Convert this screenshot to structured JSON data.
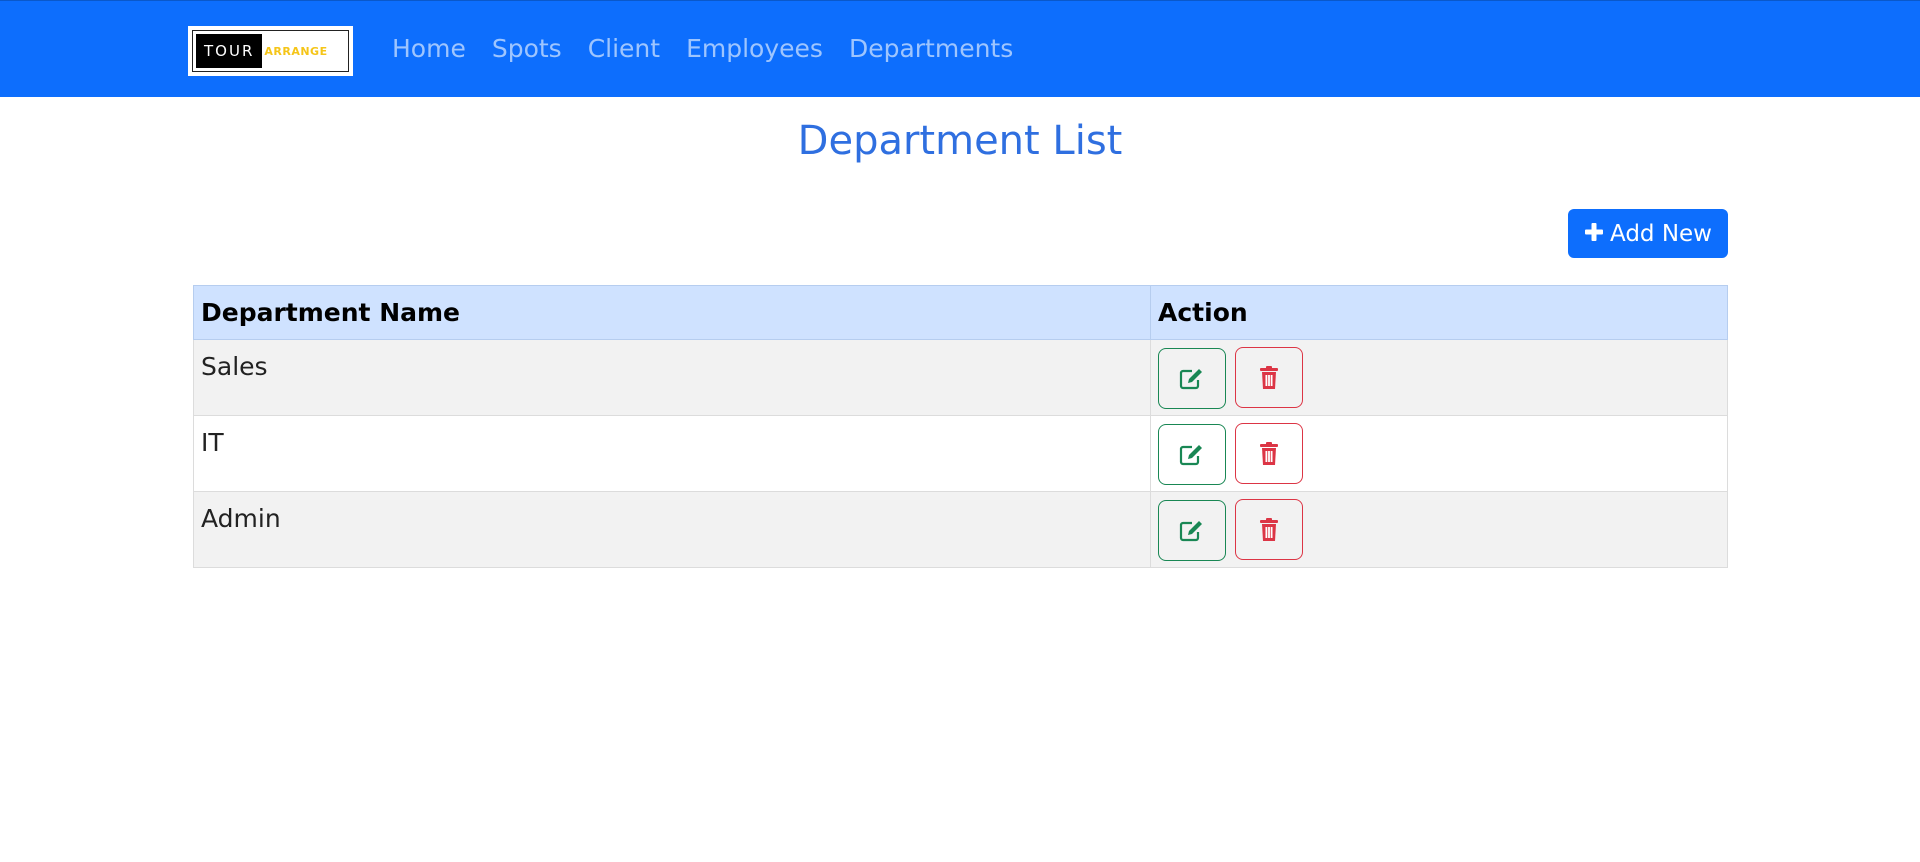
{
  "brand": {
    "part1": "TOUR",
    "part2": "ARRANGE"
  },
  "nav": {
    "items": [
      {
        "label": "Home"
      },
      {
        "label": "Spots"
      },
      {
        "label": "Client"
      },
      {
        "label": "Employees"
      },
      {
        "label": "Departments"
      }
    ]
  },
  "page": {
    "title": "Department List",
    "add_button_label": "Add New"
  },
  "table": {
    "headers": [
      "Department Name",
      "Action"
    ],
    "rows": [
      {
        "name": "Sales"
      },
      {
        "name": "IT"
      },
      {
        "name": "Admin"
      }
    ]
  },
  "colors": {
    "primary": "#0d6efd",
    "title": "#2f6fe0",
    "header_bg": "#cfe2ff",
    "edit": "#198754",
    "delete": "#dc3545"
  },
  "icons": {
    "edit": "edit-icon",
    "delete": "trash-icon",
    "add": "plus-icon"
  }
}
